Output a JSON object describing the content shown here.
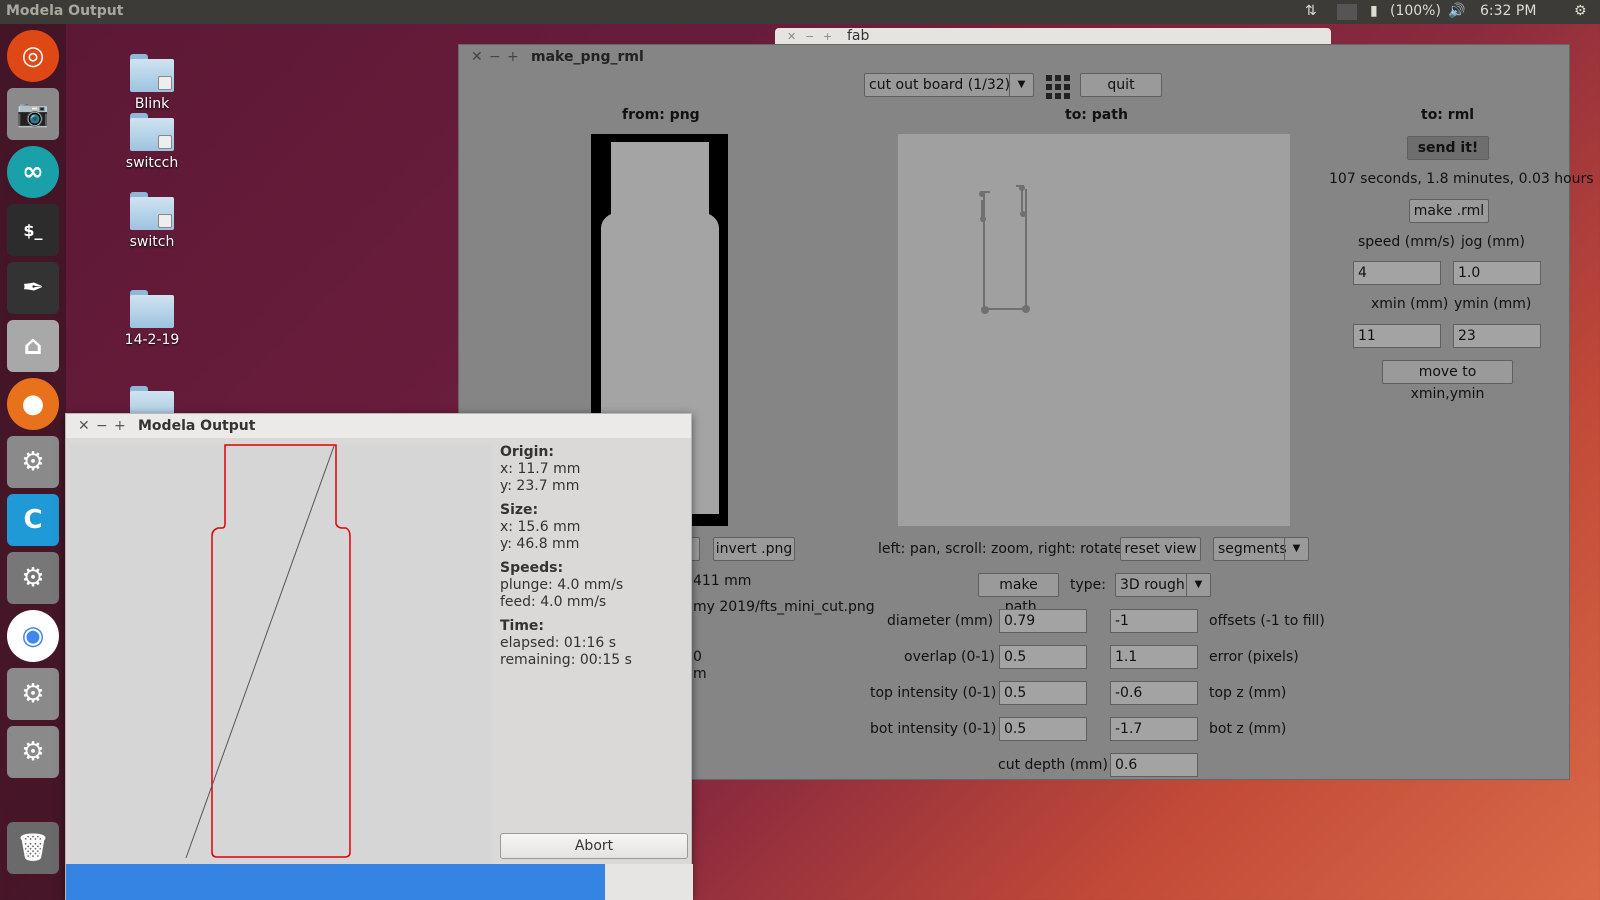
{
  "top_panel": {
    "app_title": "Modela Output",
    "battery": "(100%)",
    "clock": "6:32 PM"
  },
  "desktop_icons": [
    {
      "label": "Blink"
    },
    {
      "label": "switcch"
    },
    {
      "label": "switch"
    },
    {
      "label": "14-2-19"
    },
    {
      "label": ""
    }
  ],
  "fab_window": {
    "title": "fab"
  },
  "main_window": {
    "title": "make_png_rml",
    "mode_select": "cut out board (1/32)",
    "quit_label": "quit",
    "from_label": "from: png",
    "to_path_label": "to: path",
    "to_rml_label": "to: rml",
    "send_label": "send it!",
    "time_estimate": "107 seconds, 1.8 minutes, 0.03 hours",
    "make_rml_label": "make .rml",
    "speed_label": "speed (mm/s)",
    "jog_label": "jog (mm)",
    "speed_value": "4",
    "jog_value": "1.0",
    "xmin_label": "xmin (mm)",
    "ymin_label": "ymin (mm)",
    "xmin_value": "11",
    "ymin_value": "23",
    "move_label": "move to xmin,ymin",
    "invert_label": "invert .png",
    "partial_size": "411 mm",
    "partial_path": "my 2019/fts_mini_cut.png",
    "partial_a": "0",
    "partial_b": "m",
    "view_hint": "left: pan, scroll: zoom, right: rotate",
    "reset_view_label": "reset view",
    "display_select": "segments",
    "make_path_label": "make .path",
    "type_label": "type:",
    "type_select": "3D rough",
    "diameter_label": "diameter (mm)",
    "diameter_value": "0.79",
    "offsets_value": "-1",
    "offsets_label": "offsets (-1 to fill)",
    "overlap_label": "overlap (0-1)",
    "overlap_value": "0.5",
    "error_value": "1.1",
    "error_label": "error (pixels)",
    "top_intensity_label": "top intensity (0-1)",
    "top_intensity_value": "0.5",
    "top_z_value": "-0.6",
    "top_z_label": "top z (mm)",
    "bot_intensity_label": "bot intensity (0-1)",
    "bot_intensity_value": "0.5",
    "bot_z_value": "-1.7",
    "bot_z_label": "bot z (mm)",
    "cut_depth_label": "cut depth (mm)",
    "cut_depth_value": "0.6"
  },
  "modela_window": {
    "title": "Modela Output",
    "origin_h": "Origin:",
    "origin_x": "x: 11.7 mm",
    "origin_y": "y: 23.7 mm",
    "size_h": "Size:",
    "size_x": "x: 15.6 mm",
    "size_y": "y: 46.8 mm",
    "speeds_h": "Speeds:",
    "plunge": "plunge: 4.0 mm/s",
    "feed": "feed: 4.0 mm/s",
    "time_h": "Time:",
    "elapsed": "elapsed: 01:16 s",
    "remaining": "remaining: 00:15 s",
    "abort_label": "Abort",
    "progress_fraction": 0.86
  }
}
